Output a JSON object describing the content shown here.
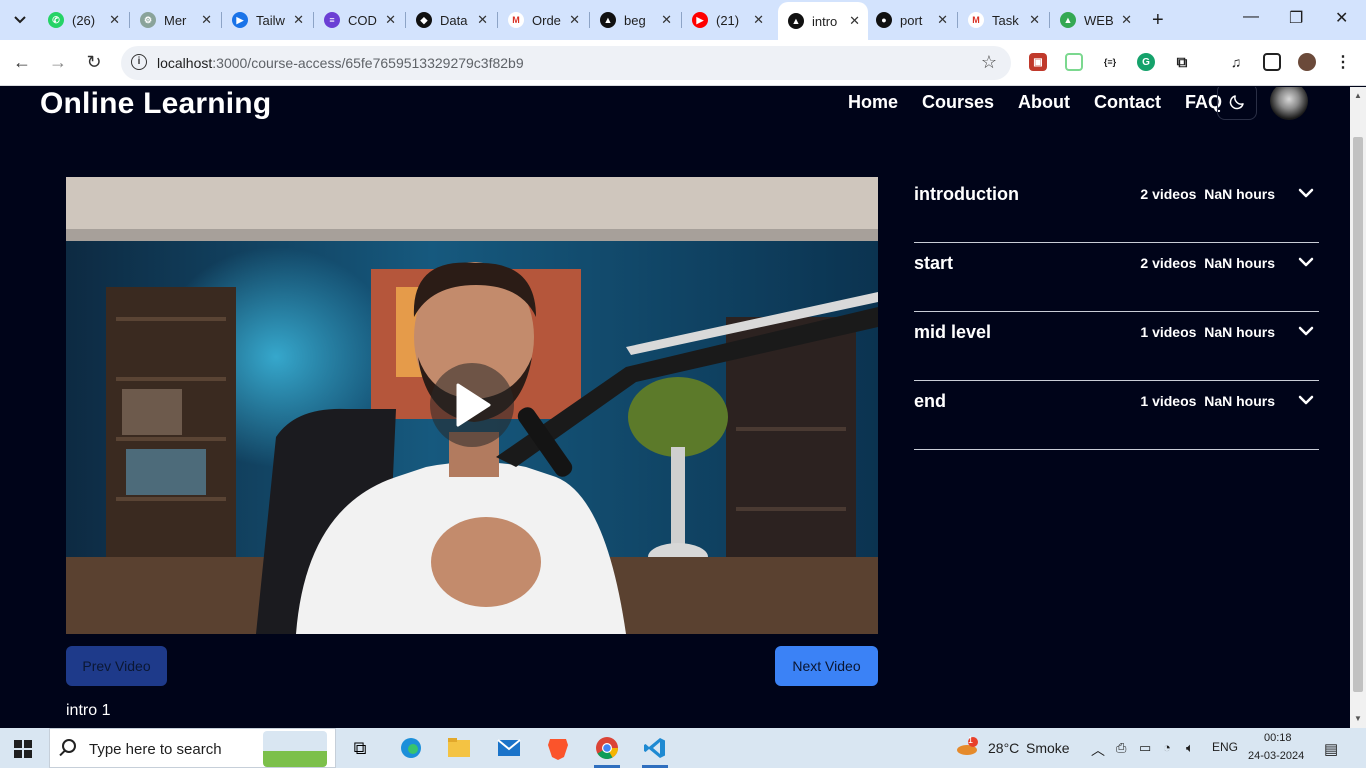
{
  "browser": {
    "tabs": [
      {
        "title": "(26)",
        "fav_color": "#25d366",
        "fav_glyph": "✆"
      },
      {
        "title": "Mer",
        "fav_color": "#8aa39a",
        "fav_glyph": "⚙"
      },
      {
        "title": "Tailw",
        "fav_color": "#1a73e8",
        "fav_glyph": "▶"
      },
      {
        "title": "COD",
        "fav_color": "#6b3fd4",
        "fav_glyph": "≡"
      },
      {
        "title": "Data",
        "fav_color": "#111111",
        "fav_glyph": "◆"
      },
      {
        "title": "Orde",
        "fav_color": "#ffffff",
        "fav_glyph": "M"
      },
      {
        "title": "beg",
        "fav_color": "#111111",
        "fav_glyph": "▲"
      },
      {
        "title": "(21)",
        "fav_color": "#ff0000",
        "fav_glyph": "▶"
      },
      {
        "title": "intro",
        "fav_color": "#111111",
        "fav_glyph": "▲",
        "active": true
      },
      {
        "title": "port",
        "fav_color": "#111111",
        "fav_glyph": "●"
      },
      {
        "title": "Task",
        "fav_color": "#ffffff",
        "fav_glyph": "M"
      },
      {
        "title": "WEB",
        "fav_color": "#34a853",
        "fav_glyph": "▲"
      }
    ],
    "url_host": "localhost",
    "url_path": ":3000/course-access/65fe7659513329279c3f82b9"
  },
  "site": {
    "brand": "Online Learning",
    "nav": [
      "Home",
      "Courses",
      "About",
      "Contact",
      "FAQ"
    ]
  },
  "player": {
    "prev_label": "Prev Video",
    "next_label": "Next Video",
    "video_title": "intro 1"
  },
  "sections": [
    {
      "name": "introduction",
      "videos": "2 videos",
      "hours": "NaN hours"
    },
    {
      "name": "start",
      "videos": "2 videos",
      "hours": "NaN hours"
    },
    {
      "name": "mid level",
      "videos": "1 videos",
      "hours": "NaN hours"
    },
    {
      "name": "end",
      "videos": "1 videos",
      "hours": "NaN hours"
    }
  ],
  "taskbar": {
    "search_placeholder": "Type here to search",
    "weather_temp": "28°C",
    "weather_text": "Smoke",
    "weather_badge": "1",
    "lang": "ENG",
    "time": "00:18",
    "date": "24-03-2024"
  },
  "colors": {
    "page_bg": "#000419",
    "prev_button": "#1e3a8a",
    "next_button": "#3b82f6"
  }
}
